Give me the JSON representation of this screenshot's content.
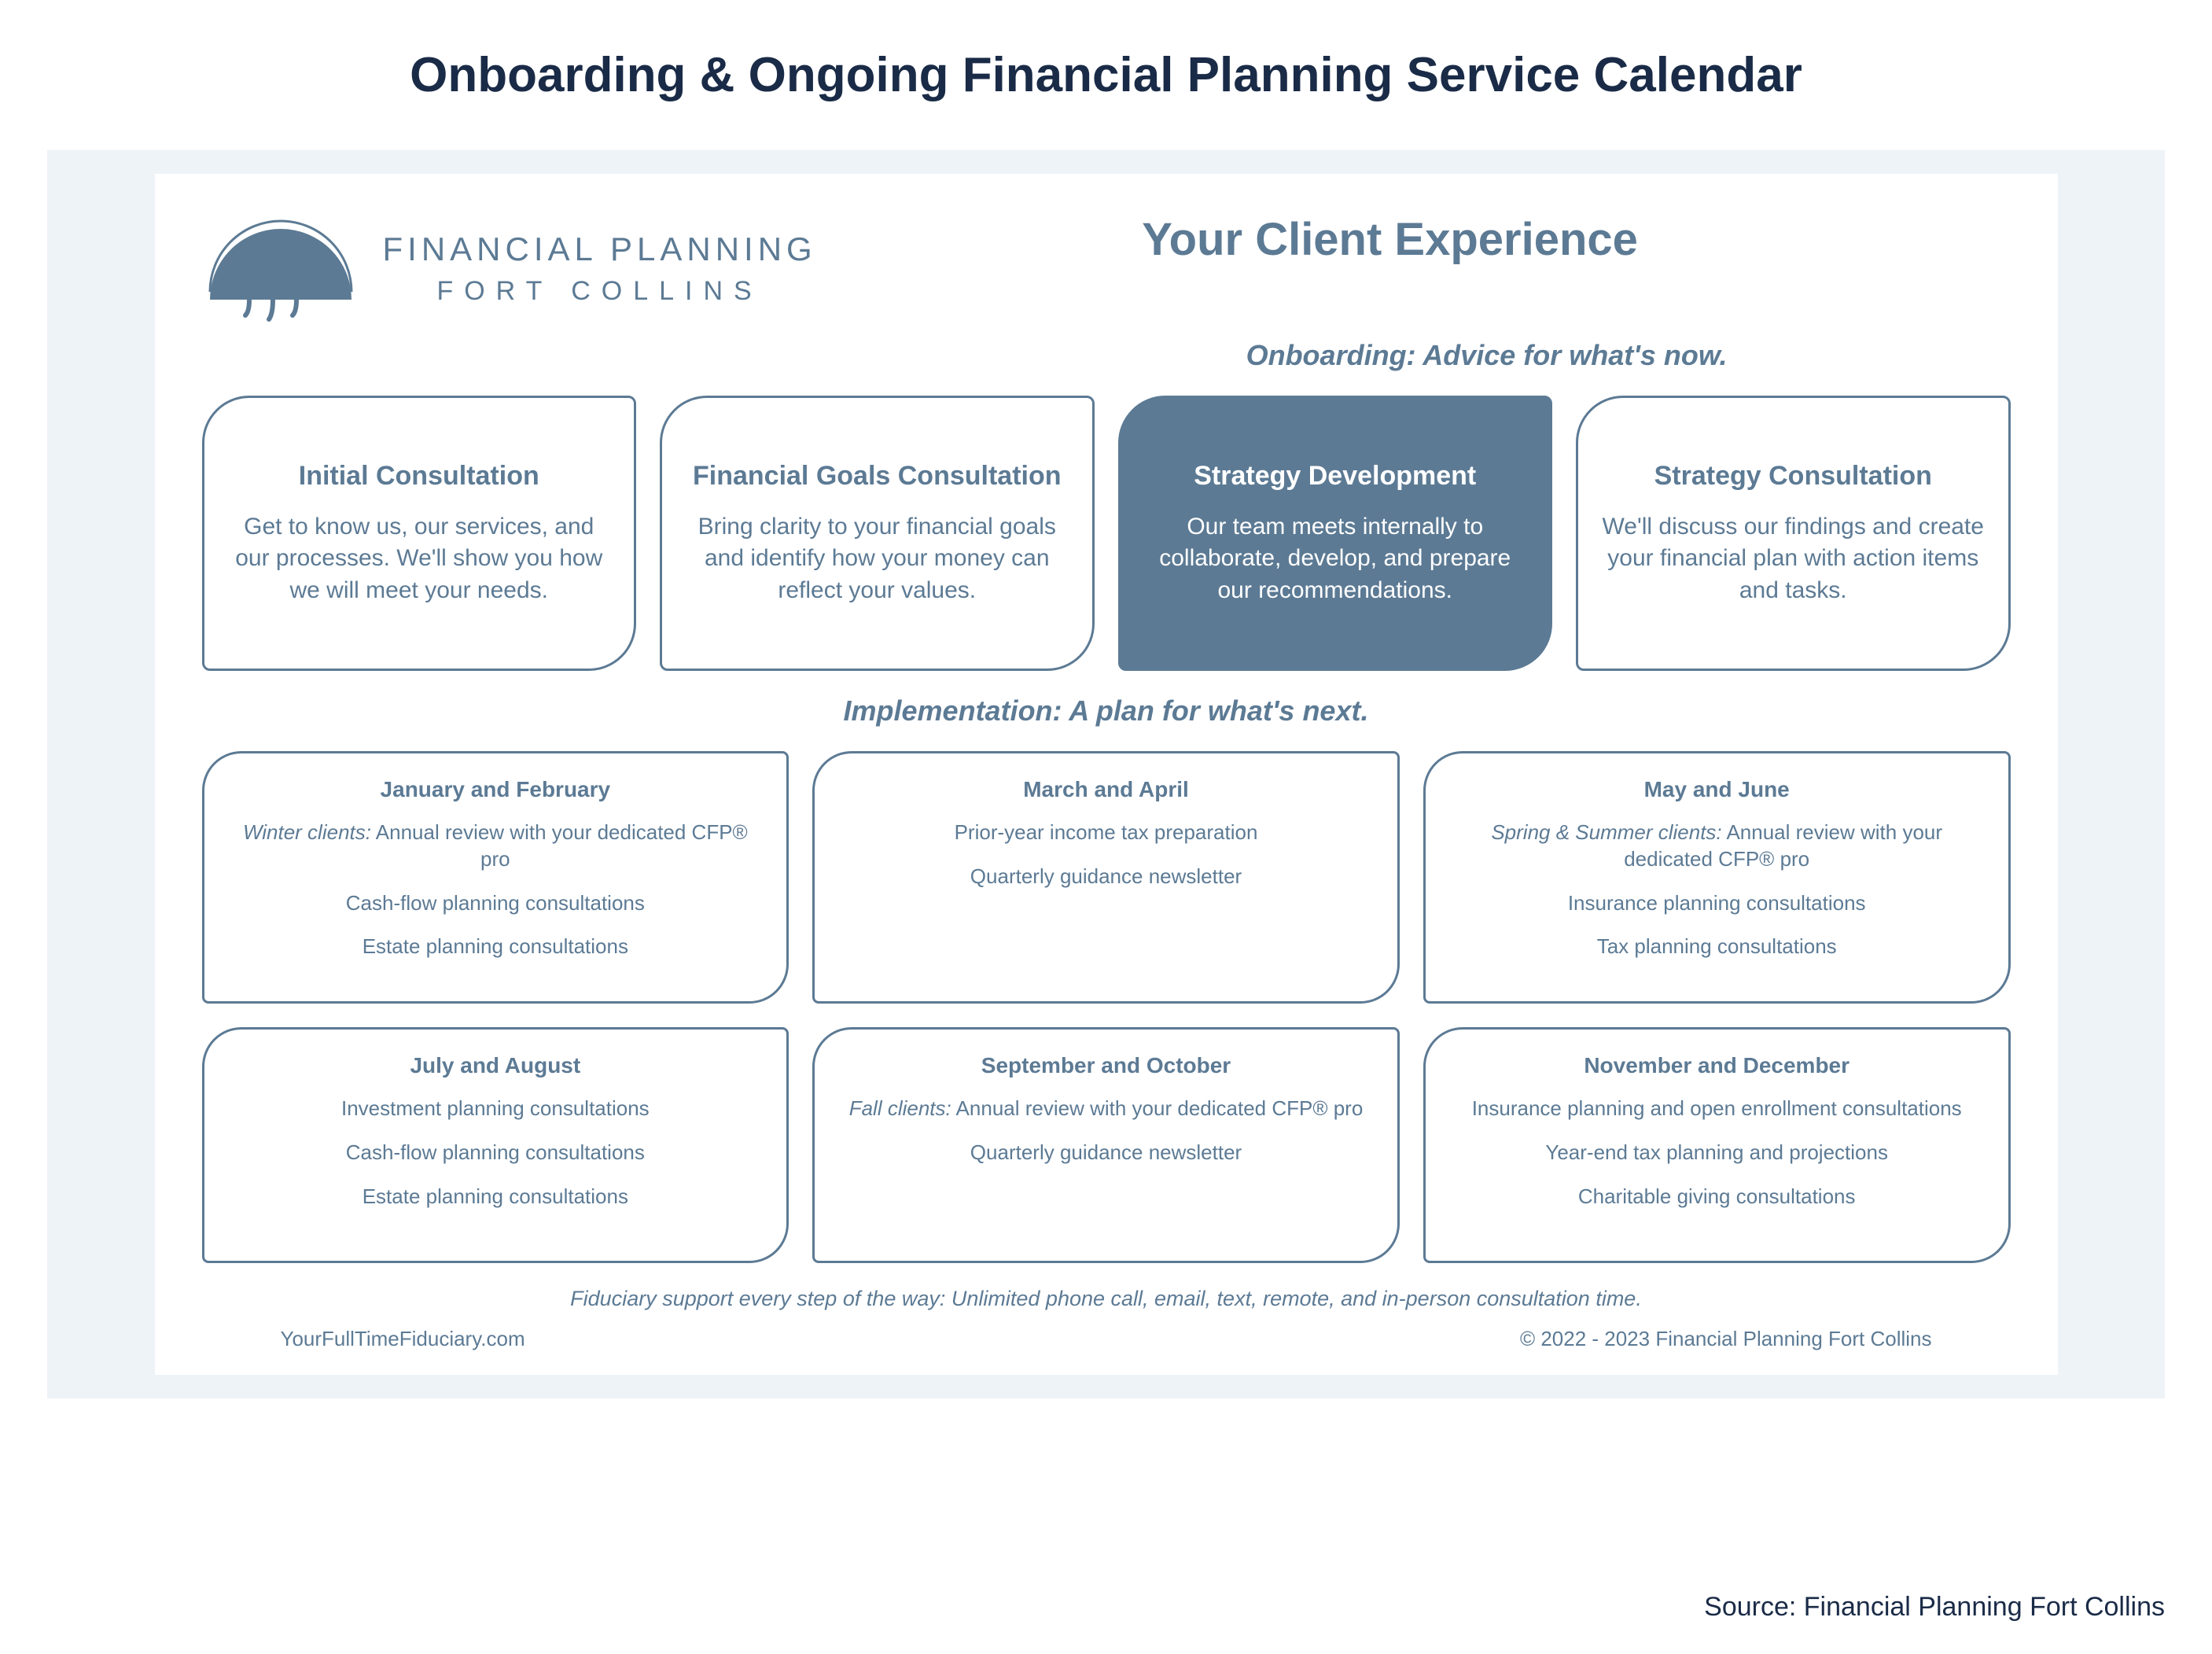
{
  "page_title": "Onboarding & Ongoing Financial Planning Service Calendar",
  "logo": {
    "line1": "FINANCIAL PLANNING",
    "line2": "FORT COLLINS"
  },
  "experience_title": "Your Client Experience",
  "onboarding_subhead": "Onboarding: Advice for what's now.",
  "stages": [
    {
      "title": "Initial Consultation",
      "body": "Get to know us, our services, and our processes. We'll show you how we will meet your needs."
    },
    {
      "title": "Financial Goals Consultation",
      "body": "Bring clarity to your financial goals and identify how your money can reflect your values."
    },
    {
      "title": "Strategy Development",
      "body": "Our team meets internally to collaborate, develop, and prepare our recommendations.",
      "filled": true
    },
    {
      "title": "Strategy Consultation",
      "body": "We'll discuss our findings and create your financial plan with action items and tasks."
    }
  ],
  "implementation_subhead": "Implementation: A plan for what's next.",
  "months_row1": [
    {
      "title": "January and February",
      "line1_em": "Winter clients:",
      "line1_rest": " Annual review with your dedicated CFP® pro",
      "line2": "Cash-flow planning consultations",
      "line3": "Estate planning consultations"
    },
    {
      "title": "March and April",
      "line1": "Prior-year income tax preparation",
      "line2": "Quarterly guidance newsletter",
      "line3": ""
    },
    {
      "title": "May and June",
      "line1_em": "Spring & Summer clients:",
      "line1_rest": " Annual review with your dedicated CFP® pro",
      "line2": "Insurance planning consultations",
      "line3": "Tax planning consultations"
    }
  ],
  "months_row2": [
    {
      "title": "July and August",
      "line1": "Investment planning consultations",
      "line2": "Cash-flow planning consultations",
      "line3": "Estate planning consultations"
    },
    {
      "title": "September and October",
      "line1_em": "Fall clients:",
      "line1_rest": " Annual review with your dedicated CFP® pro",
      "line2": "Quarterly guidance newsletter",
      "line3": ""
    },
    {
      "title": "November and December",
      "line1": "Insurance planning and open enrollment consultations",
      "line2": "Year-end tax planning and projections",
      "line3": "Charitable giving consultations"
    }
  ],
  "fiduciary_line": "Fiduciary support every step of the way: Unlimited phone call, email, text, remote, and in-person consultation time.",
  "footer_left": "YourFullTimeFiduciary.com",
  "footer_right": "© 2022 - 2023 Financial Planning Fort Collins",
  "source": "Source: Financial Planning Fort Collins"
}
